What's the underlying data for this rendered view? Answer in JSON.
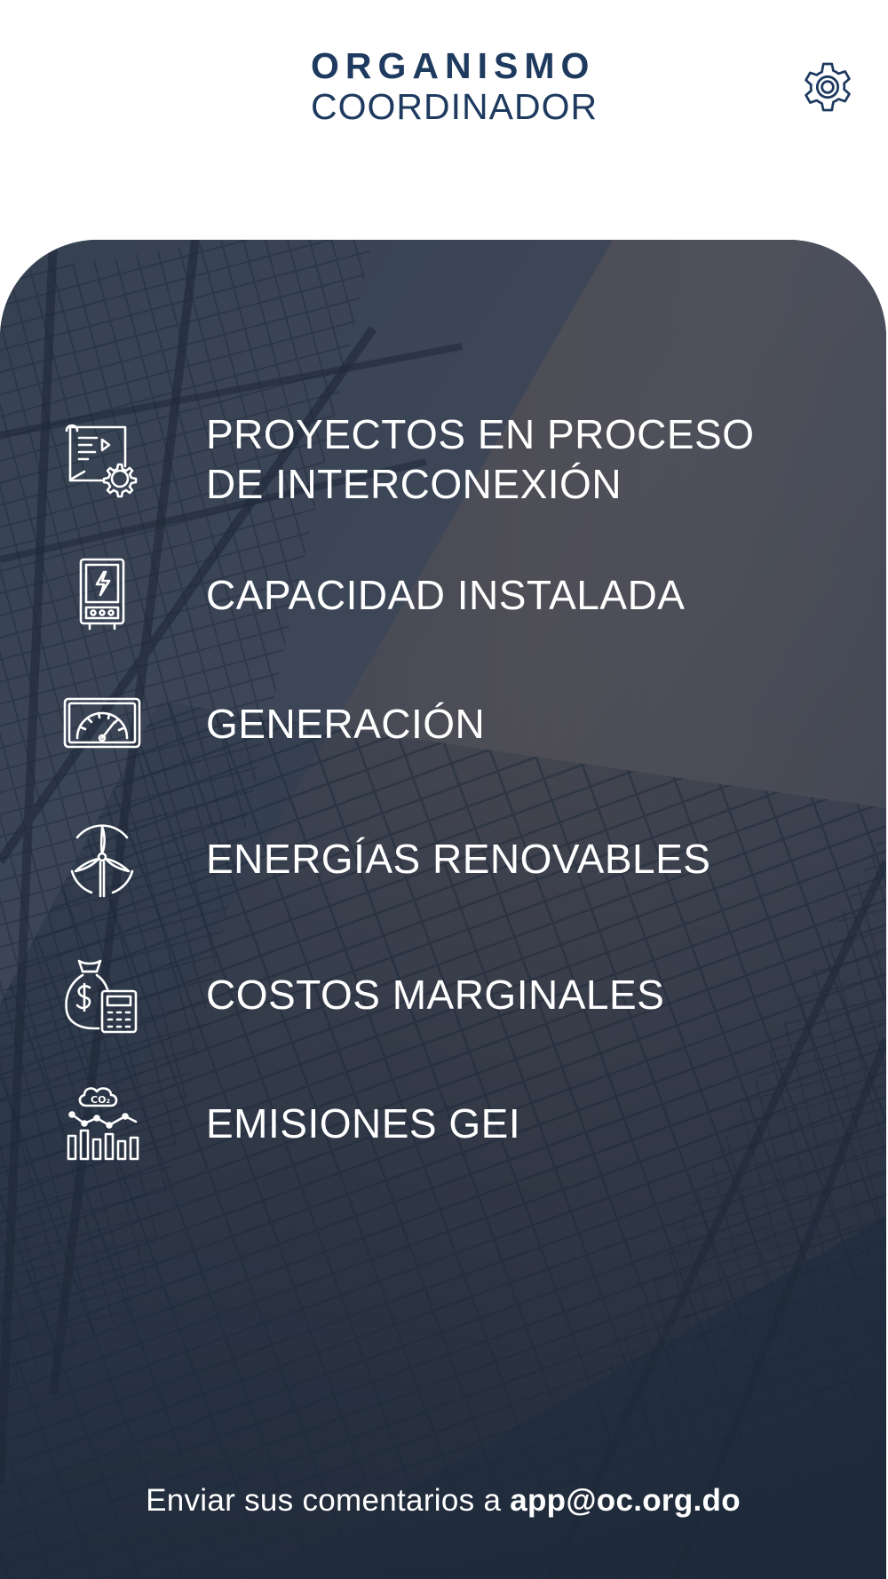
{
  "header": {
    "logo_line1": "ORGANISMO",
    "logo_line2": "COORDINADOR",
    "settings_icon": "gear-icon"
  },
  "menu": [
    {
      "label": "PROYECTOS EN PROCESO\nDE INTERCONEXIÓN",
      "icon": "blueprint-gear-icon"
    },
    {
      "label": "CAPACIDAD INSTALADA",
      "icon": "power-cabinet-icon"
    },
    {
      "label": "GENERACIÓN",
      "icon": "gauge-meter-icon"
    },
    {
      "label": "ENERGÍAS RENOVABLES",
      "icon": "wind-turbine-icon"
    },
    {
      "label": "COSTOS MARGINALES",
      "icon": "money-bag-calculator-icon"
    },
    {
      "label": "EMISIONES GEI",
      "icon": "co2-emissions-chart-icon"
    }
  ],
  "footer": {
    "text": "Enviar sus comentarios a ",
    "email": "app@oc.org.do"
  },
  "colors": {
    "brand": "#1e3a5f",
    "card_overlay": "#2b3646",
    "text_light": "#ffffff"
  }
}
